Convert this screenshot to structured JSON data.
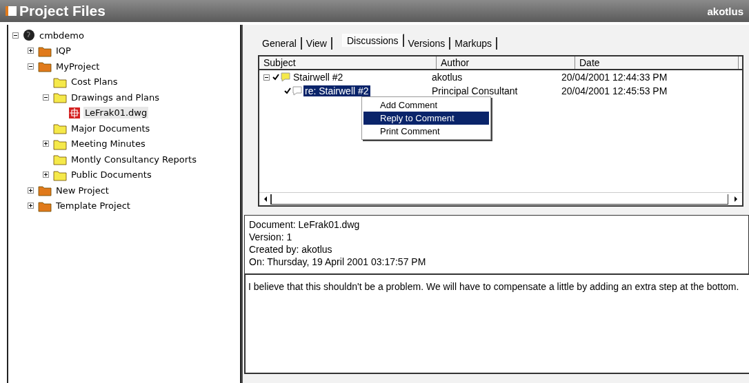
{
  "window": {
    "title": "Project Files",
    "user": "akotlus"
  },
  "tree": [
    {
      "label": "cmbdemo",
      "kind": "server",
      "expanded": true,
      "selected": false,
      "children": [
        {
          "label": "IQP",
          "kind": "project",
          "expanded": false,
          "selected": false
        },
        {
          "label": "MyProject",
          "kind": "project",
          "expanded": true,
          "selected": false,
          "children": [
            {
              "label": "Cost Plans",
              "kind": "folder",
              "selected": false
            },
            {
              "label": "Drawings and Plans",
              "kind": "folder",
              "expanded": true,
              "selected": false,
              "children": [
                {
                  "label": "LeFrak01.dwg",
                  "kind": "file",
                  "selected": true
                }
              ]
            },
            {
              "label": "Major Documents",
              "kind": "folder",
              "selected": false
            },
            {
              "label": "Meeting Minutes",
              "kind": "folder",
              "expanded": false,
              "selected": false
            },
            {
              "label": "Montly Consultancy Reports",
              "kind": "folder",
              "selected": false
            },
            {
              "label": "Public Documents",
              "kind": "folder",
              "expanded": false,
              "selected": false
            }
          ]
        },
        {
          "label": "New Project",
          "kind": "project",
          "expanded": false,
          "selected": false
        },
        {
          "label": "Template Project",
          "kind": "project",
          "expanded": false,
          "selected": false
        }
      ]
    }
  ],
  "tabs": [
    {
      "label": "General",
      "selected": false
    },
    {
      "label": "View",
      "selected": false
    },
    {
      "label": "Discussions",
      "selected": true
    },
    {
      "label": "Versions",
      "selected": false
    },
    {
      "label": "Markups",
      "selected": false
    }
  ],
  "discussions": {
    "columns": [
      "Subject",
      "Author",
      "Date"
    ],
    "rows": [
      {
        "subject": "Stairwell #2",
        "author": "akotlus",
        "date": "20/04/2001  12:44:33 PM",
        "kind": "topic",
        "checked": true,
        "expanded": true,
        "selected": false,
        "children": [
          {
            "subject": "re: Stairwell #2",
            "author": "Principal Consultant",
            "date": "20/04/2001  12:45:53 PM",
            "kind": "reply",
            "checked": true,
            "selected": true
          }
        ]
      }
    ]
  },
  "context_menu": [
    {
      "label": "Add Comment",
      "selected": false
    },
    {
      "label": "Reply to Comment",
      "selected": true
    },
    {
      "label": "Print Comment",
      "selected": false
    }
  ],
  "details": [
    "Document: LeFrak01.dwg",
    "Version: 1",
    "Created by: akotlus",
    "On: Thursday, 19 April 2001  03:17:57 PM"
  ],
  "comment": "I believe that this shouldn't be a problem.  We will have to compensate a little by adding an extra step at the bottom."
}
